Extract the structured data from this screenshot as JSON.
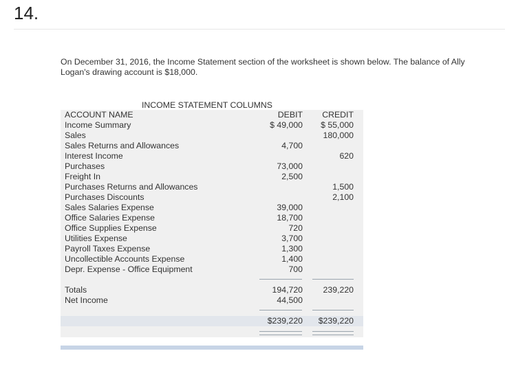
{
  "question_number": "14.",
  "intro_text": "On December 31, 2016, the Income Statement section of the worksheet is shown below. The balance of Ally Logan's drawing account is $18,000.",
  "worksheet": {
    "title": "INCOME STATEMENT COLUMNS",
    "col_account": "ACCOUNT NAME",
    "col_debit": "DEBIT",
    "col_credit": "CREDIT",
    "rows": [
      {
        "name": "Income Summary",
        "debit": "$ 49,000",
        "credit": "$ 55,000"
      },
      {
        "name": "Sales",
        "debit": "",
        "credit": "180,000"
      },
      {
        "name": "Sales Returns and Allowances",
        "debit": "4,700",
        "credit": ""
      },
      {
        "name": "Interest Income",
        "debit": "",
        "credit": "620"
      },
      {
        "name": "Purchases",
        "debit": "73,000",
        "credit": ""
      },
      {
        "name": "Freight In",
        "debit": "2,500",
        "credit": ""
      },
      {
        "name": "Purchases Returns and Allowances",
        "debit": "",
        "credit": "1,500"
      },
      {
        "name": "Purchases Discounts",
        "debit": "",
        "credit": "2,100"
      },
      {
        "name": "Sales Salaries Expense",
        "debit": "39,000",
        "credit": ""
      },
      {
        "name": "Office Salaries Expense",
        "debit": "18,700",
        "credit": ""
      },
      {
        "name": "Office Supplies Expense",
        "debit": "720",
        "credit": ""
      },
      {
        "name": "Utilities Expense",
        "debit": "3,700",
        "credit": ""
      },
      {
        "name": "Payroll Taxes Expense",
        "debit": "1,300",
        "credit": ""
      },
      {
        "name": "Uncollectible Accounts Expense",
        "debit": "1,400",
        "credit": ""
      },
      {
        "name": "Depr. Expense - Office Equipment",
        "debit": "700",
        "credit": ""
      }
    ],
    "totals": {
      "name": "Totals",
      "debit": "194,720",
      "credit": "239,220"
    },
    "net_income": {
      "name": "Net Income",
      "debit": "44,500",
      "credit": ""
    },
    "final": {
      "debit": "$239,220",
      "credit": "$239,220"
    }
  }
}
